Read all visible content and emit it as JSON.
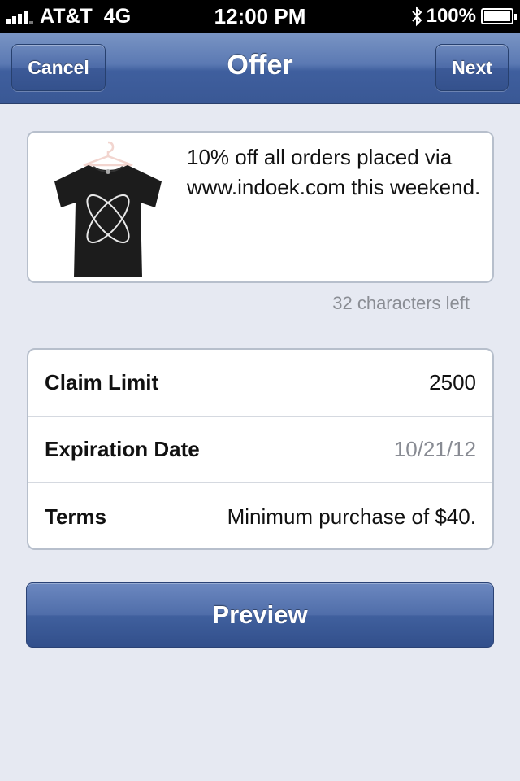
{
  "status_bar": {
    "carrier": "AT&T",
    "network": "4G",
    "time": "12:00 PM",
    "battery": "100%",
    "battery_level": 1.0,
    "signal_bars": 4
  },
  "nav": {
    "title": "Offer",
    "cancel_label": "Cancel",
    "next_label": "Next"
  },
  "offer": {
    "text": "10% off all orders placed via www.indoek.com this weekend.",
    "image_icon": "tshirt-image",
    "chars_left": "32 characters left"
  },
  "details": [
    {
      "label": "Claim Limit",
      "value": "2500",
      "muted": false
    },
    {
      "label": "Expiration Date",
      "value": "10/21/12",
      "muted": true
    },
    {
      "label": "Terms",
      "value": "Minimum purchase of $40.",
      "muted": false
    }
  ],
  "preview_label": "Preview",
  "colors": {
    "nav_blue": "#4a6aa8",
    "background": "#e6e9f2",
    "muted_text": "#888b93"
  }
}
